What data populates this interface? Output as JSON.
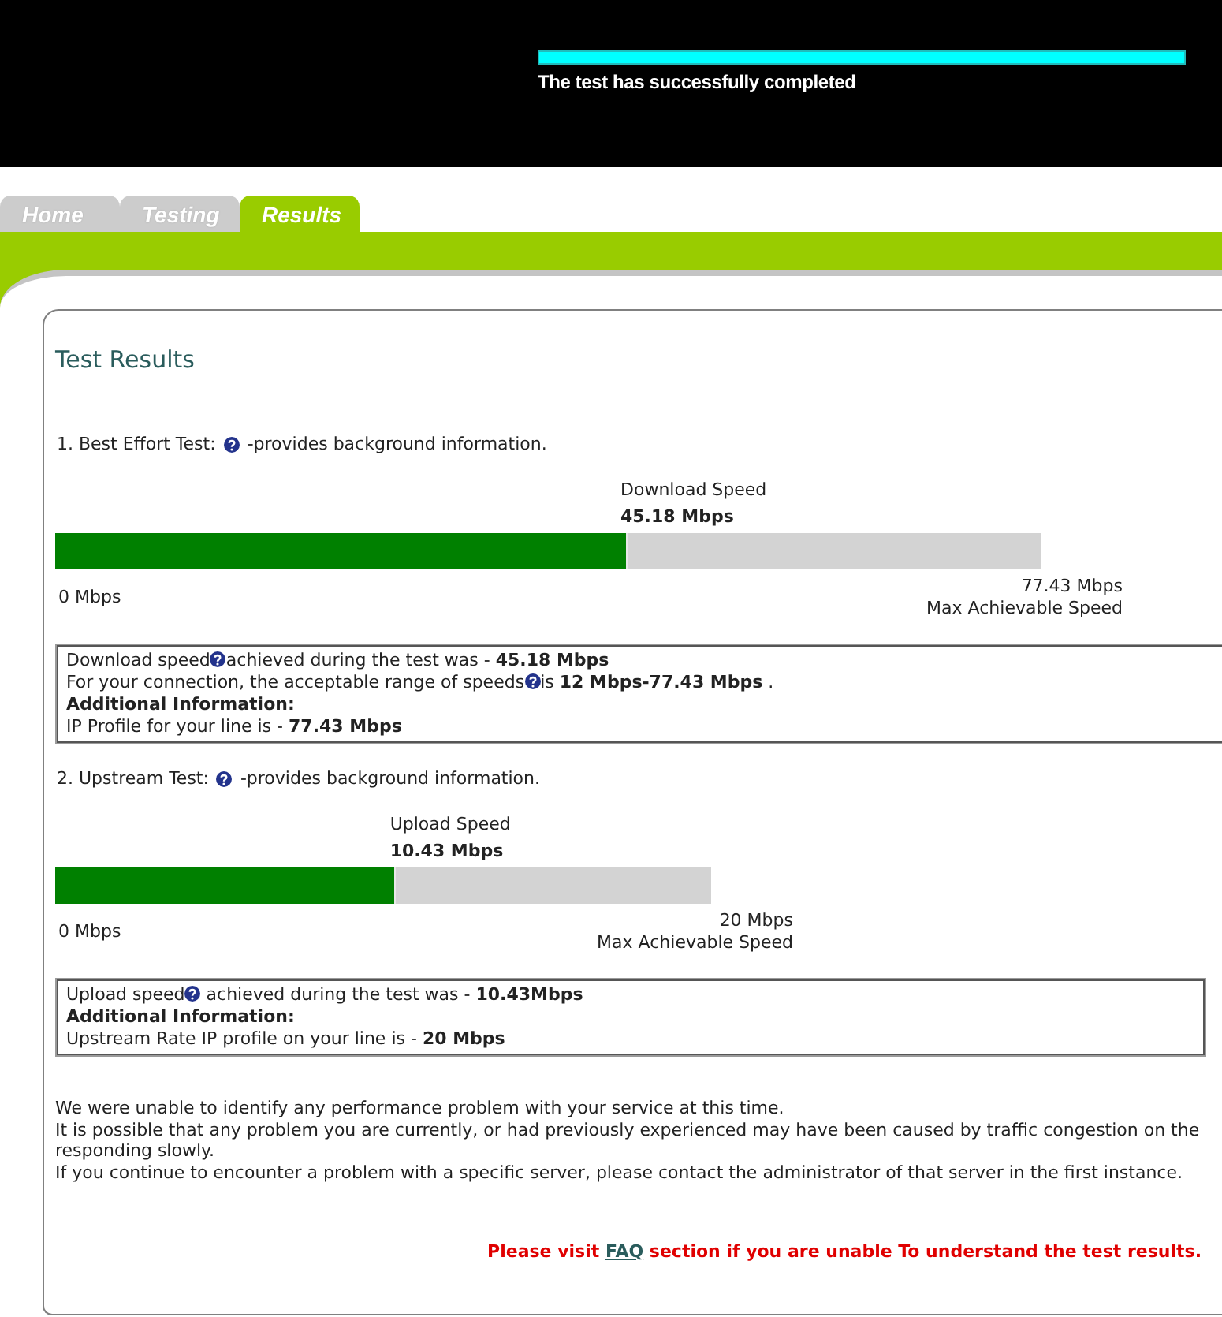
{
  "header": {
    "progress": {
      "level": 1
    },
    "message": "The test has successfully completed"
  },
  "tabs": [
    {
      "label": "Home",
      "selected": false
    },
    {
      "label": "Testing",
      "selected": false
    },
    {
      "label": "Results",
      "selected": true
    }
  ],
  "results": {
    "title": "Test Results",
    "tests": [
      {
        "kind": "download",
        "label": "1. Best Effort Test:",
        "note": "-provides background information.",
        "gauge": {
          "title": "Download Speed",
          "reading": "45.18 Mbps",
          "level": 0.58,
          "min_label": "0 Mbps",
          "max_label": "77.43 Mbps",
          "max_caption": "Max Achievable Speed"
        },
        "summary": [
          {
            "kind": "help",
            "before": "Download speed",
            "after": "achieved during the test was - **45.18 Mbps**"
          },
          {
            "kind": "help",
            "before": "For your connection, the acceptable range of speeds",
            "after": "is **12 Mbps-77.43 Mbps** ."
          },
          {
            "kind": "heading",
            "text": "Additional Information:"
          },
          {
            "kind": "text",
            "text": "IP Profile for your line is - **77.43 Mbps**"
          }
        ]
      },
      {
        "kind": "upload",
        "label": "2. Upstream Test:",
        "note": "-provides background information.",
        "gauge": {
          "title": "Upload Speed",
          "reading": "10.43 Mbps",
          "level": 0.52,
          "min_label": "0 Mbps",
          "max_label": "20 Mbps",
          "max_caption": "Max Achievable Speed"
        },
        "summary": [
          {
            "kind": "help",
            "before": "Upload speed",
            "after": " achieved during the test was - **10.43Mbps**"
          },
          {
            "kind": "heading",
            "text": "Additional Information:"
          },
          {
            "kind": "text",
            "text": "Upstream Rate IP profile on your line is - **20 Mbps**"
          }
        ]
      }
    ],
    "message_lines": [
      "We were unable to identify any performance problem with your service at this time.",
      "It is possible that any problem you are currently, or had previously experienced may have been caused by traffic congestion on the",
      "responding slowly.",
      "If you continue to encounter a problem with a specific server, please contact the administrator of that server in the first instance."
    ],
    "footer_note": {
      "before": "Please visit",
      "link": "FAQ",
      "after": "section if you are unable To understand the test results."
    }
  }
}
